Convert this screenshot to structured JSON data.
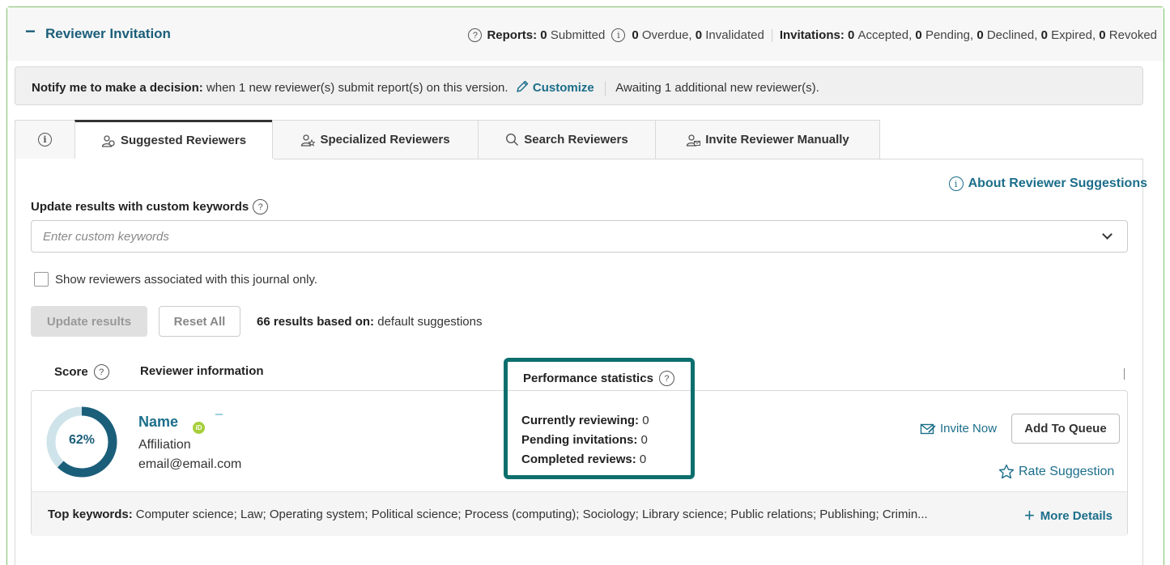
{
  "panel": {
    "collapse_symbol": "−",
    "title": "Reviewer Invitation",
    "stats": {
      "reports_label": "Reports:",
      "submitted_count": "0",
      "submitted_label": "Submitted",
      "overdue_count": "0",
      "overdue_label": "Overdue,",
      "invalidated_count": "0",
      "invalidated_label": "Invalidated",
      "invitations_label": "Invitations:",
      "accepted_count": "0",
      "accepted_label": "Accepted,",
      "pending_count": "0",
      "pending_label": "Pending,",
      "declined_count": "0",
      "declined_label": "Declined,",
      "expired_count": "0",
      "expired_label": "Expired,",
      "revoked_count": "0",
      "revoked_label": "Revoked"
    }
  },
  "notify": {
    "label": "Notify me to make a decision:",
    "text": "when 1 new reviewer(s) submit report(s) on this version.",
    "customize": "Customize",
    "awaiting": "Awaiting 1 additional new reviewer(s)."
  },
  "tabs": [
    {
      "label": ""
    },
    {
      "label": "Suggested Reviewers"
    },
    {
      "label": "Specialized Reviewers"
    },
    {
      "label": "Search Reviewers"
    },
    {
      "label": "Invite Reviewer Manually"
    }
  ],
  "about_link": "About Reviewer Suggestions",
  "keywords": {
    "label": "Update results with custom keywords",
    "placeholder": "Enter custom keywords"
  },
  "journal_only_label": "Show reviewers associated with this journal only.",
  "buttons": {
    "update": "Update results",
    "reset": "Reset All"
  },
  "results": {
    "count_text": "66 results based on:",
    "basis": "default suggestions"
  },
  "columns": {
    "score": "Score",
    "reviewer_info": "Reviewer information",
    "performance": "Performance statistics"
  },
  "reviewer": {
    "score_text": "62%",
    "score_fraction": 0.62,
    "orcid_text": "iD",
    "name": "Name",
    "affiliation": "Affiliation",
    "email": "email@email.com",
    "currently_reviewing_label": "Currently reviewing:",
    "currently_reviewing": "0",
    "pending_invitations_label": "Pending invitations:",
    "pending_invitations": "0",
    "completed_reviews_label": "Completed reviews:",
    "completed_reviews": "0",
    "invite_now": "Invite Now",
    "add_to_queue": "Add To Queue",
    "rate_suggestion": "Rate Suggestion",
    "top_keywords_label": "Top keywords:",
    "top_keywords": "Computer science; Law; Operating system; Political science; Process (computing); Sociology; Library science; Public relations; Publishing; Crimin...",
    "more_details": "More Details"
  },
  "colors": {
    "accent": "#1b6e8a",
    "highlight_box": "#0d6e6e",
    "panel_border": "#7cc46a",
    "gauge_track": "#cfe3ea",
    "gauge_fill": "#1b5e7a"
  }
}
